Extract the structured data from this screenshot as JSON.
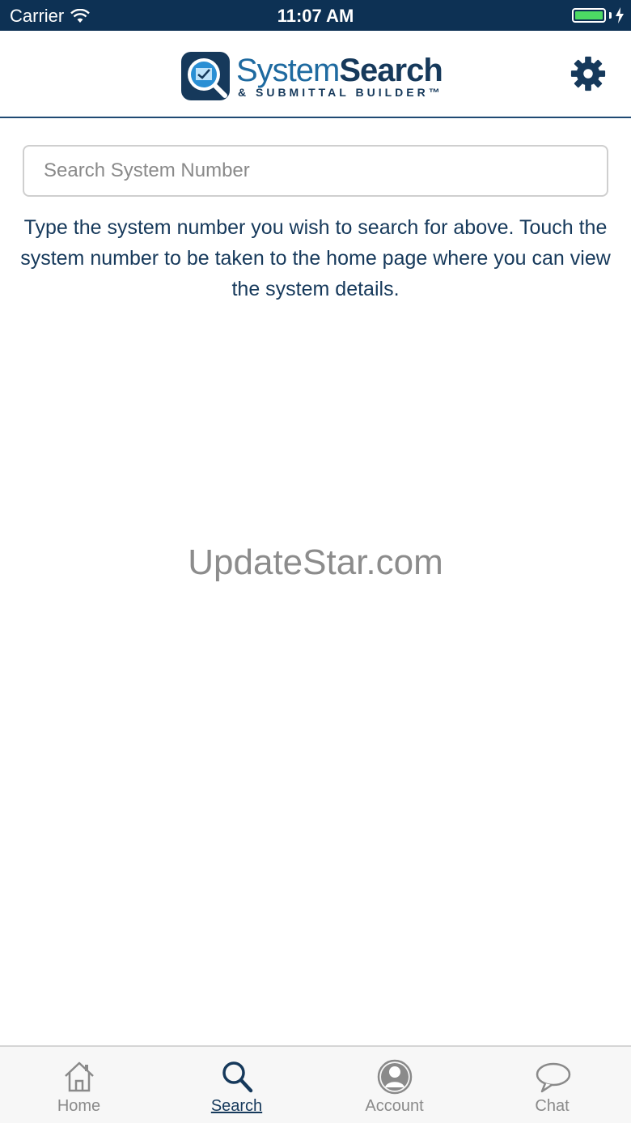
{
  "status_bar": {
    "carrier": "Carrier",
    "time": "11:07 AM",
    "battery_color": "#4cd964",
    "background": "#0d3154"
  },
  "header": {
    "logo_title_light": "System",
    "logo_title_bold": "Search",
    "logo_subtitle": "& SUBMITTAL BUILDER™",
    "settings_icon": "gear-icon"
  },
  "search": {
    "placeholder": "Search System Number",
    "value": ""
  },
  "instructions": "Type the system number you wish to search for above. Touch the system number to be taken to the home page where you can view the system details.",
  "watermark": "UpdateStar.com",
  "tabs": [
    {
      "label": "Home",
      "icon": "home-icon",
      "active": false
    },
    {
      "label": "Search",
      "icon": "search-icon",
      "active": true
    },
    {
      "label": "Account",
      "icon": "account-icon",
      "active": false
    },
    {
      "label": "Chat",
      "icon": "chat-icon",
      "active": false
    }
  ],
  "colors": {
    "accent": "#16395b",
    "inactive": "#8a8a8a"
  }
}
